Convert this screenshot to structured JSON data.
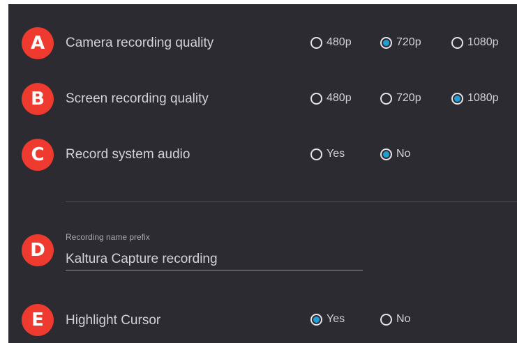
{
  "settings": [
    {
      "badge": "A",
      "label": "Camera recording quality",
      "options": [
        {
          "label": "480p",
          "selected": false
        },
        {
          "label": "720p",
          "selected": true
        },
        {
          "label": "1080p",
          "selected": false
        }
      ]
    },
    {
      "badge": "B",
      "label": "Screen recording quality",
      "options": [
        {
          "label": "480p",
          "selected": false
        },
        {
          "label": "720p",
          "selected": false
        },
        {
          "label": "1080p",
          "selected": true
        }
      ]
    },
    {
      "badge": "C",
      "label": "Record system audio",
      "options": [
        {
          "label": "Yes",
          "selected": false
        },
        {
          "label": "No",
          "selected": true
        }
      ]
    }
  ],
  "prefix_field": {
    "badge": "D",
    "label": "Recording name prefix",
    "value": "Kaltura Capture recording"
  },
  "cursor_setting": {
    "badge": "E",
    "label": "Highlight Cursor",
    "options": [
      {
        "label": "Yes",
        "selected": true
      },
      {
        "label": "No",
        "selected": false
      }
    ]
  },
  "colors": {
    "background": "#2b2b31",
    "badge": "#ef3b2f",
    "radio_selected": "#1ea0d6",
    "text": "#d2d2d6"
  }
}
